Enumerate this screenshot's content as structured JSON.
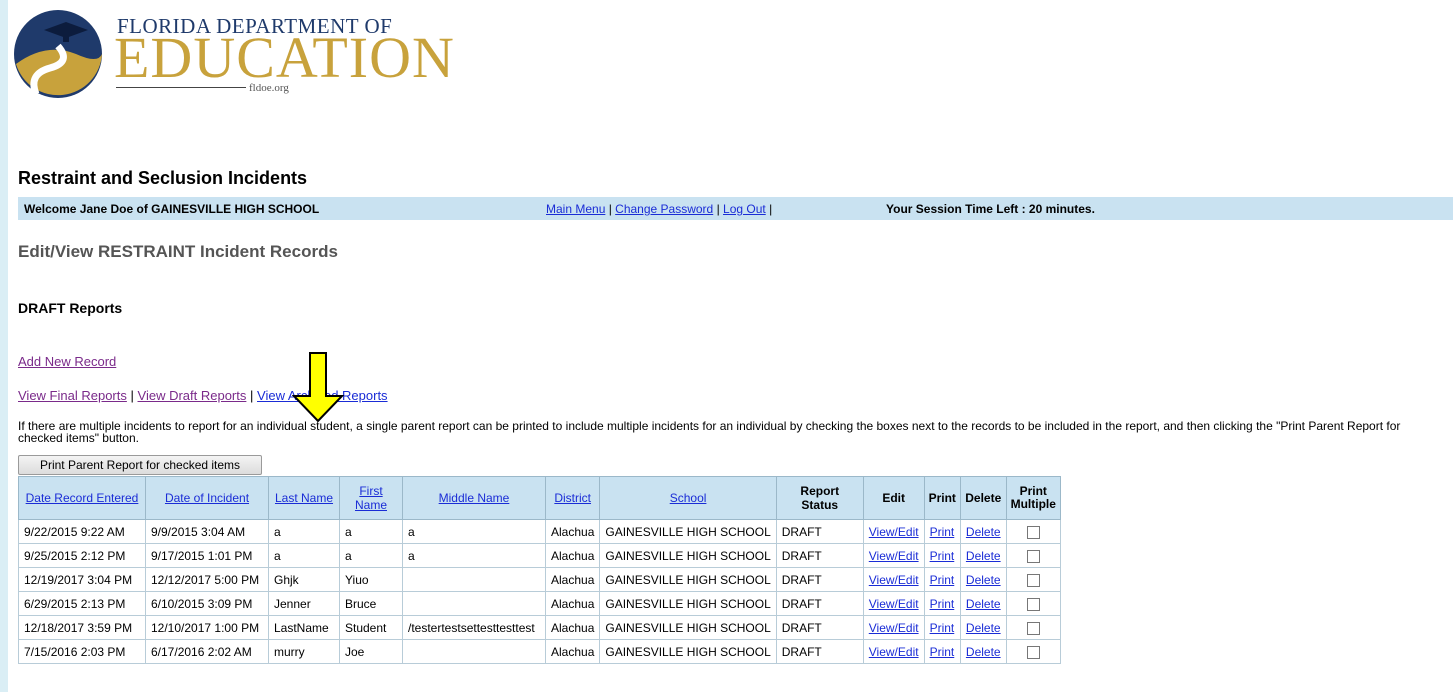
{
  "logo": {
    "line1": "FLORIDA DEPARTMENT OF",
    "line2": "EDUCATION",
    "url": "fldoe.org"
  },
  "app_title": "Restraint and Seclusion Incidents",
  "welcome": {
    "text": "Welcome Jane Doe of GAINESVILLE HIGH SCHOOL",
    "links": [
      "Main Menu",
      "Change Password",
      "Log Out"
    ],
    "session": "Your Session Time Left : 20 minutes."
  },
  "section_title": "Edit/View RESTRAINT Incident Records",
  "draft_title": "DRAFT Reports",
  "add_new": "Add New Record",
  "report_links": [
    "View Final Reports",
    "View Draft Reports",
    "View Archived Reports"
  ],
  "instructions": "If there are multiple incidents to report for an individual student, a single parent report can be printed to include multiple incidents for an individual by checking the boxes next to the records to be included in the report, and then clicking the \"Print Parent Report for checked items\" button.",
  "print_button": "Print Parent Report for checked items",
  "table": {
    "headers": [
      "Date Record Entered",
      "Date of Incident",
      "Last Name",
      "First Name",
      "Middle Name",
      "District",
      "School",
      "Report Status",
      "Edit",
      "Print",
      "Delete",
      "Print Multiple"
    ],
    "rows": [
      [
        "9/22/2015 9:22 AM",
        "9/9/2015 3:04 AM",
        "a",
        "a",
        "a",
        "Alachua",
        "GAINESVILLE HIGH SCHOOL",
        "DRAFT",
        "View/Edit",
        "Print",
        "Delete"
      ],
      [
        "9/25/2015 2:12 PM",
        "9/17/2015 1:01 PM",
        "a",
        "a",
        "a",
        "Alachua",
        "GAINESVILLE HIGH SCHOOL",
        "DRAFT",
        "View/Edit",
        "Print",
        "Delete"
      ],
      [
        "12/19/2017 3:04 PM",
        "12/12/2017 5:00 PM",
        "Ghjk",
        "Yiuo",
        "",
        "Alachua",
        "GAINESVILLE HIGH SCHOOL",
        "DRAFT",
        "View/Edit",
        "Print",
        "Delete"
      ],
      [
        "6/29/2015 2:13 PM",
        "6/10/2015 3:09 PM",
        "Jenner",
        "Bruce",
        "",
        "Alachua",
        "GAINESVILLE HIGH SCHOOL",
        "DRAFT",
        "View/Edit",
        "Print",
        "Delete"
      ],
      [
        "12/18/2017 3:59 PM",
        "12/10/2017 1:00 PM",
        "LastName",
        "Student",
        "/testertestsettesttesttest",
        "Alachua",
        "GAINESVILLE HIGH SCHOOL",
        "DRAFT",
        "View/Edit",
        "Print",
        "Delete"
      ],
      [
        "7/15/2016 2:03 PM",
        "6/17/2016 2:02 AM",
        "murry",
        "Joe",
        "",
        "Alachua",
        "GAINESVILLE HIGH SCHOOL",
        "DRAFT",
        "View/Edit",
        "Print",
        "Delete"
      ]
    ]
  },
  "colors": {
    "page_bg": "#daeef5",
    "header_bg": "#c9e2f1",
    "link": "#1a2cd6",
    "visited_link": "#7a2a8a",
    "arrow_fill": "#ffff00"
  }
}
